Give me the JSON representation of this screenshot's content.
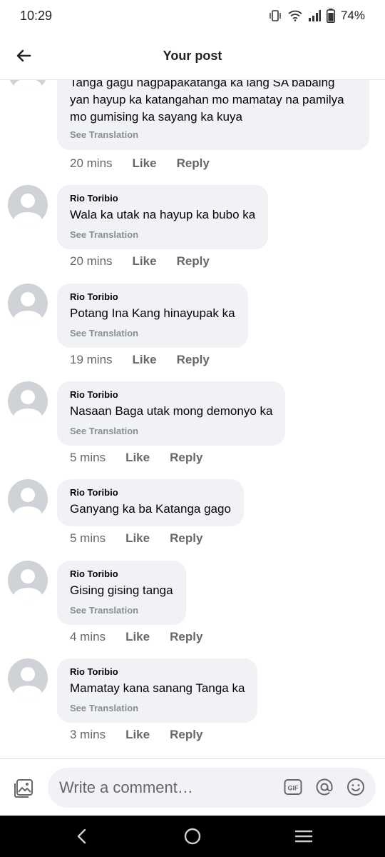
{
  "status": {
    "time": "10:29",
    "battery": "74%"
  },
  "header": {
    "title": "Your post"
  },
  "partial_comment": {
    "lines": [
      "Tanga gagu nagpapakatanga ka lang SA babaing",
      "yan hayup ka katangahan mo mamatay na pamilya",
      "mo gumising ka sayang ka kuya"
    ],
    "see_translation": "See Translation",
    "time": "20 mins",
    "like": "Like",
    "reply": "Reply"
  },
  "comments": [
    {
      "author": "Rio Toribio",
      "text": "Wala ka utak na hayup ka bubo ka",
      "see_translation": "See Translation",
      "time": "20 mins",
      "like": "Like",
      "reply": "Reply"
    },
    {
      "author": "Rio Toribio",
      "text": "Potang Ina Kang hinayupak ka",
      "see_translation": "See Translation",
      "time": "19 mins",
      "like": "Like",
      "reply": "Reply"
    },
    {
      "author": "Rio Toribio",
      "text": "Nasaan Baga utak mong demonyo ka",
      "see_translation": "See Translation",
      "time": "5 mins",
      "like": "Like",
      "reply": "Reply"
    },
    {
      "author": "Rio Toribio",
      "text": "Ganyang ka ba Katanga gago",
      "see_translation": "",
      "time": "5 mins",
      "like": "Like",
      "reply": "Reply"
    },
    {
      "author": "Rio Toribio",
      "text": "Gising gising tanga",
      "see_translation": "See Translation",
      "time": "4 mins",
      "like": "Like",
      "reply": "Reply"
    },
    {
      "author": "Rio Toribio",
      "text": "Mamatay kana sanang Tanga ka",
      "see_translation": "See Translation",
      "time": "3 mins",
      "like": "Like",
      "reply": "Reply"
    }
  ],
  "composer": {
    "placeholder": "Write a comment…",
    "gif_label": "GIF"
  },
  "icons": {
    "back": "arrow-left-icon",
    "photo": "photo-icon",
    "gif": "gif-icon",
    "mention": "at-icon",
    "emoji": "emoji-icon",
    "nav_back": "nav-back-icon",
    "nav_home": "nav-home-icon",
    "nav_recents": "nav-recents-icon"
  }
}
